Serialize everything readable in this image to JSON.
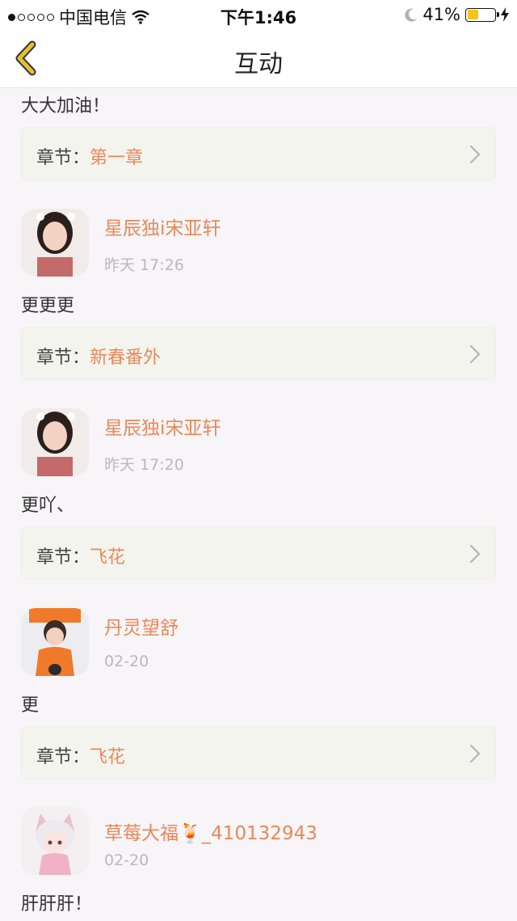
{
  "status_bar": {
    "carrier": "中国电信",
    "time": "下午1:46",
    "battery": "41%",
    "battery_level": 0.41
  },
  "header": {
    "title": "互动"
  },
  "chapter_prefix": "章节：",
  "items": [
    {
      "comment": "大大加油！",
      "chapter": "第一章"
    },
    {
      "user": "星辰独i宋亚轩",
      "time": "昨天 17:26",
      "comment": "更更更",
      "chapter": "新春番外"
    },
    {
      "user": "星辰独i宋亚轩",
      "time": "昨天 17:20",
      "comment": "更吖、",
      "chapter": "飞花"
    },
    {
      "user": "丹灵望舒",
      "time": "02-20",
      "comment": "更",
      "chapter": "飞花"
    },
    {
      "user": "草莓大福🍹_410132943",
      "time": "02-20",
      "comment": "肝肝肝！"
    }
  ],
  "colors": {
    "accent": "#e8895a",
    "card_bg": "#f4f4ee",
    "battery": "#f5c518",
    "back_arrow": "#d9b12a"
  },
  "icons": {
    "back": "chevron-left-icon",
    "row": "chevron-right-icon"
  }
}
